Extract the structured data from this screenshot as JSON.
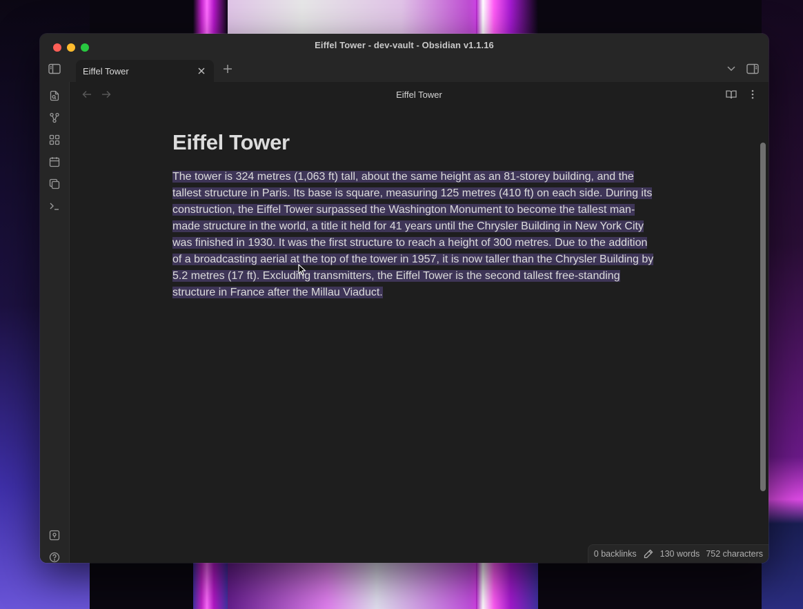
{
  "window": {
    "title": "Eiffel Tower - dev-vault - Obsidian v1.1.16"
  },
  "tabs": [
    {
      "label": "Eiffel Tower",
      "active": true
    }
  ],
  "view": {
    "title": "Eiffel Tower"
  },
  "note": {
    "heading": "Eiffel Tower",
    "body": "The tower is 324 metres (1,063 ft) tall, about the same height as an 81-storey building, and the tallest structure in Paris. Its base is square, measuring 125 metres (410 ft) on each side. During its construction, the Eiffel Tower surpassed the Washington Monument to become the tallest man-made structure in the world, a title it held for 41 years until the Chrysler Building in New York City was finished in 1930. It was the first structure to reach a height of 300 metres. Due to the addition of a broadcasting aerial at the top of the tower in 1957, it is now taller than the Chrysler Building by 5.2 metres (17 ft). Excluding transmitters, the Eiffel Tower is the second tallest free-standing structure in France after the Millau Viaduct."
  },
  "status": {
    "backlinks": "0 backlinks",
    "words": "130 words",
    "characters": "752 characters"
  },
  "ribbon_icons": [
    "open-quick-switcher-icon",
    "graph-view-icon",
    "canvas-icon",
    "daily-note-icon",
    "templates-icon",
    "command-palette-icon",
    "vault-switcher-icon",
    "help-icon",
    "settings-icon"
  ],
  "colors": {
    "selection": "#3e3557",
    "window_bg": "#1e1e1e",
    "chrome_bg": "#262626"
  }
}
